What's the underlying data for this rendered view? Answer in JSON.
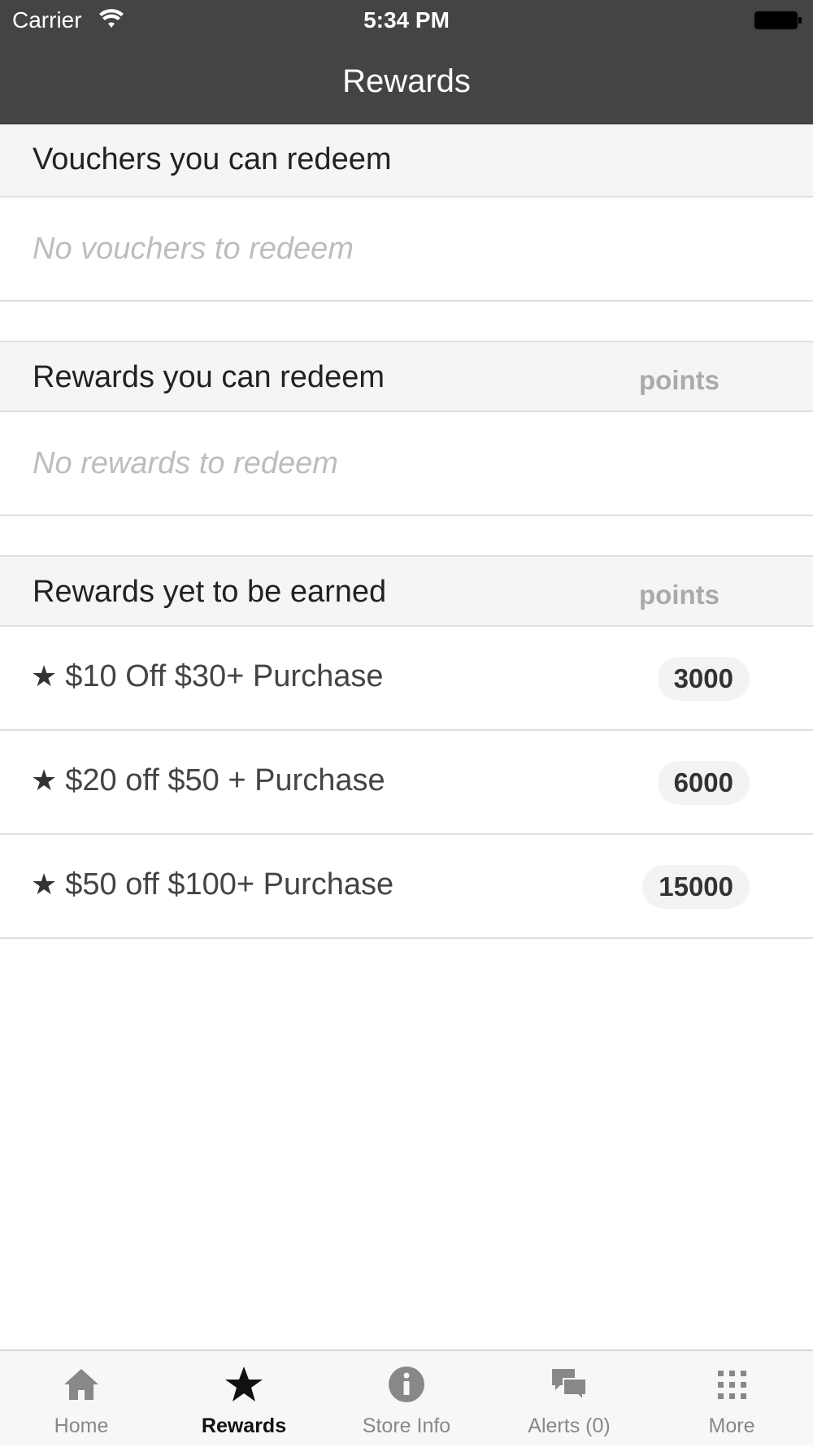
{
  "status_bar": {
    "carrier": "Carrier",
    "time": "5:34 PM"
  },
  "nav": {
    "title": "Rewards"
  },
  "sections": {
    "vouchers": {
      "title": "Vouchers you can redeem",
      "empty_text": "No vouchers to redeem"
    },
    "redeemable": {
      "title": "Rewards you can redeem",
      "points_label": "points",
      "empty_text": "No rewards to redeem"
    },
    "to_earn": {
      "title": "Rewards yet to be earned",
      "points_label": "points",
      "items": [
        {
          "star": "★",
          "label": "$10 Off $30+ Purchase",
          "points": "3000"
        },
        {
          "star": "★",
          "label": "$20 off $50 + Purchase",
          "points": "6000"
        },
        {
          "star": "★",
          "label": "$50 off $100+ Purchase",
          "points": "15000"
        }
      ]
    }
  },
  "tabbar": {
    "tabs": [
      {
        "label": "Home",
        "icon": "home-icon"
      },
      {
        "label": "Rewards",
        "icon": "star-icon",
        "active": true
      },
      {
        "label": "Store Info",
        "icon": "info-icon"
      },
      {
        "label": "Alerts (0)",
        "icon": "chat-bubbles-icon"
      },
      {
        "label": "More",
        "icon": "grid-icon"
      }
    ]
  },
  "colors": {
    "header_bg": "#444444",
    "section_bg": "#f5f5f5",
    "tab_active": "#111111",
    "tab_inactive": "#888888"
  }
}
